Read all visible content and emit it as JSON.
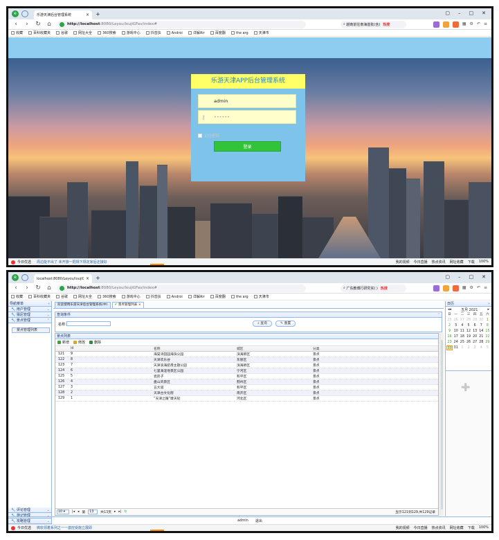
{
  "window1": {
    "tab_title": "乐游天津后台管理系统",
    "url_host": "http://localhost",
    "url_rest": ":8080/Leyou/loujiGFav/index#",
    "search_text": "越南前往南海首批(含)",
    "search_hot": "热搜",
    "status_left": "今日优选",
    "status_news": "周边能不出了 未开旅一把规下规定家后还接好",
    "status_right": [
      "我的视频",
      "今日直播",
      "热点资讯",
      "网址收藏",
      "下载",
      "100%"
    ],
    "login": {
      "title": "乐游天津APP后台管理系统",
      "username": "admin",
      "password": "••••••",
      "remember_label": "记住密码",
      "login_button": "登录"
    }
  },
  "window2": {
    "tab_title": "localhost:8080/Leyou/loujiGF/...",
    "url_host": "http://localhost",
    "url_rest": ":8080/Leyou/loujiGFav/index#",
    "search_text": "广东教博行研究实( )",
    "search_hot": "热搜",
    "status_left": "今日优选",
    "status_news": "微软领着系列之一一激控受施立展即",
    "status_right": [
      "我的视频",
      "今日直播",
      "热点资讯",
      "网址收藏",
      "下载",
      "100%"
    ],
    "west_title": "导航菜单",
    "accordion_top": [
      "用户管理",
      "猜尼管理",
      "景点管理"
    ],
    "active_menu_item": "景点管理列表",
    "accordion_bottom": [
      "评论管理",
      "游记管理",
      "攻略管理"
    ],
    "center_tabs": [
      "欢迎使用乐游天津后台管理系统(中)",
      "景点管理列表"
    ],
    "query_panel_title": "查询条件",
    "query_label": "名称：",
    "query_button": "查询",
    "reset_button": "重置",
    "list_title": "景点列表",
    "toolbar": [
      "新增",
      "修改",
      "删除"
    ],
    "columns": [
      "id",
      "名称",
      "城区",
      "分类"
    ],
    "rows": [
      [
        "121",
        "9",
        "海棠湾田园海滨公园",
        "滨海新区",
        "景点"
      ],
      [
        "122",
        "8",
        "天津欢乐谷",
        "东丽区",
        "景点"
      ],
      [
        "123",
        "7",
        "天津滨海航母主题公园",
        "滨海新区",
        "景点"
      ],
      [
        "124",
        "6",
        "七里海湿地景区公园",
        "宁河区",
        "景点"
      ],
      [
        "125",
        "5",
        "瓷房子",
        "和平区",
        "景点"
      ],
      [
        "126",
        "4",
        "盘山风景区",
        "蓟州区",
        "景点"
      ],
      [
        "127",
        "3",
        "五大道",
        "和平区",
        "景点"
      ],
      [
        "128",
        "2",
        "天津古文化街",
        "南开区",
        "景点"
      ],
      [
        "129",
        "1",
        "“天津之眼”摩天轮",
        "河北区",
        "景点"
      ]
    ],
    "pager": {
      "page_size": "10",
      "page_label": "第",
      "page_value": "13",
      "page_total": "共13页",
      "info": "显示121到129,共129记录"
    },
    "calendar": {
      "title": "日历",
      "month": "五月 2021",
      "weekdays": [
        "日",
        "一",
        "二",
        "三",
        "四",
        "五",
        "六"
      ],
      "days": [
        [
          "25",
          "26",
          "27",
          "28",
          "29",
          "30",
          "1"
        ],
        [
          "2",
          "3",
          "4",
          "5",
          "6",
          "7",
          "8"
        ],
        [
          "9",
          "10",
          "11",
          "12",
          "13",
          "14",
          "15"
        ],
        [
          "16",
          "17",
          "18",
          "19",
          "20",
          "21",
          "22"
        ],
        [
          "23",
          "24",
          "25",
          "26",
          "27",
          "28",
          "29"
        ],
        [
          "30",
          "31",
          "1",
          "2",
          "3",
          "4",
          "5"
        ]
      ],
      "today": "30"
    },
    "footer_user": "admin",
    "footer_logout": "退出"
  },
  "bookmarks": [
    "收藏",
    "百科收藏夹",
    "谷歌",
    "网址大全",
    "360搜索",
    "游戏中心",
    "抖音扶",
    "Androi",
    "详解Air",
    "百度翻",
    "the arg",
    "天津市"
  ],
  "colors": {
    "login_title_bg": "#ffff66",
    "login_box_bg": "#7ec3ea",
    "login_button_bg": "#31c33a",
    "easyui_border": "#95b8e7",
    "easyui_header": "#e0ecff"
  }
}
